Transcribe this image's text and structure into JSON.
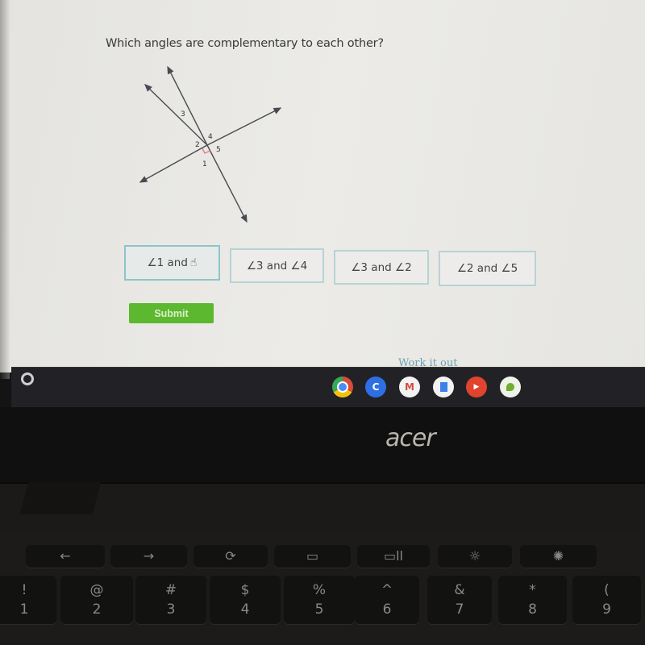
{
  "question": {
    "text": "Which angles are complementary to each other?"
  },
  "diagram": {
    "angle_labels": [
      "1",
      "2",
      "3",
      "4",
      "5"
    ],
    "right_angle_marker_color": "#e07070",
    "line_color": "#4a4a52"
  },
  "choices": [
    {
      "label": "∠1 and ∠5",
      "visible_text": "∠1 and",
      "hovered": true
    },
    {
      "label": "∠3 and ∠4",
      "hovered": false
    },
    {
      "label": "∠3 and ∠2",
      "hovered": false
    },
    {
      "label": "∠2 and ∠5",
      "hovered": false
    }
  ],
  "submit": {
    "label": "Submit",
    "color": "#5cb82f"
  },
  "work_it_out": {
    "label": "Work it out"
  },
  "shelf": {
    "launcher_icon": "launcher-circle-icon",
    "apps": [
      {
        "name": "chrome",
        "icon": "chrome-icon"
      },
      {
        "name": "classroom-c",
        "icon": "c-app-icon",
        "glyph": "C"
      },
      {
        "name": "gmail",
        "icon": "gmail-icon",
        "glyph": "M"
      },
      {
        "name": "docs",
        "icon": "docs-icon"
      },
      {
        "name": "youtube",
        "icon": "youtube-icon",
        "glyph": "▶"
      },
      {
        "name": "app-green",
        "icon": "green-app-icon"
      }
    ]
  },
  "laptop": {
    "brand": "acer"
  },
  "keyboard": {
    "function_row": [
      "←",
      "→",
      "⟳",
      "▭",
      "▭ll",
      "☼",
      "✺"
    ],
    "number_row": [
      {
        "sym": "!",
        "num": "1"
      },
      {
        "sym": "@",
        "num": "2"
      },
      {
        "sym": "#",
        "num": "3"
      },
      {
        "sym": "$",
        "num": "4"
      },
      {
        "sym": "%",
        "num": "5"
      },
      {
        "sym": "^",
        "num": "6"
      },
      {
        "sym": "&",
        "num": "7"
      },
      {
        "sym": "*",
        "num": "8"
      },
      {
        "sym": "(",
        "num": "9"
      }
    ]
  }
}
